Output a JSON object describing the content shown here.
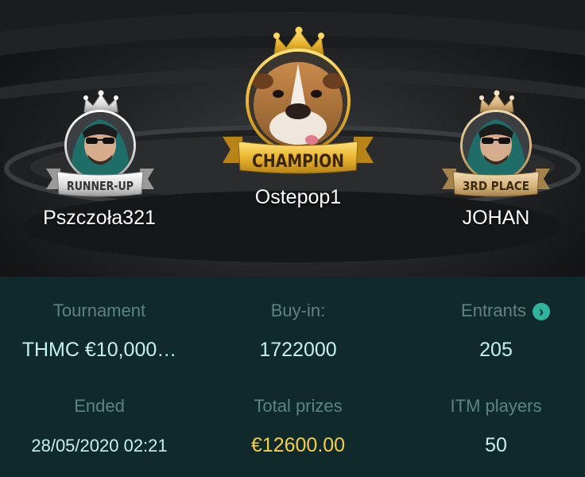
{
  "winners": {
    "champion": {
      "badge": "CHAMPION",
      "name": "Ostepop1",
      "avatar": "bulldog-avatar"
    },
    "runner_up": {
      "badge": "RUNNER-UP",
      "name": "Pszczoła321",
      "avatar": "hooded-player-avatar"
    },
    "third_place": {
      "badge": "3RD PLACE",
      "name": "JOHAN",
      "avatar": "hooded-player-avatar"
    }
  },
  "stats": {
    "tournament": {
      "label": "Tournament",
      "value": "THMC €10,000…"
    },
    "buy_in": {
      "label": "Buy-in:",
      "value": "1722000"
    },
    "entrants": {
      "label": "Entrants",
      "value": "205",
      "icon": "chevron-right-circle-icon"
    },
    "ended": {
      "label": "Ended",
      "value": "28/05/2020 02:21"
    },
    "total_prizes": {
      "label": "Total prizes",
      "value": "€12600.00"
    },
    "itm_players": {
      "label": "ITM players",
      "value": "50"
    }
  },
  "colors": {
    "label": "#5e8282",
    "value": "#c6f0f0",
    "prize": "#f3cf47",
    "accent": "#2fb49d",
    "panel": "#102a2c"
  }
}
